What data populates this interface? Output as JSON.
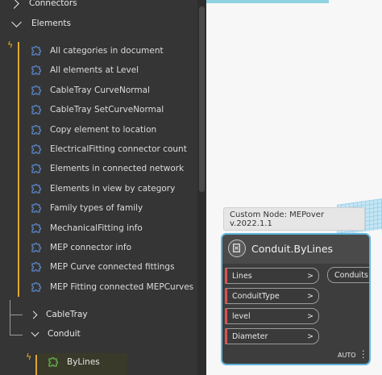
{
  "library": {
    "connectors_label": "Connectors",
    "elements_label": "Elements",
    "items": [
      {
        "label": "All categories in document"
      },
      {
        "label": "All elements at Level"
      },
      {
        "label": "CableTray CurveNormal"
      },
      {
        "label": "CableTray SetCurveNormal"
      },
      {
        "label": "Copy element to location"
      },
      {
        "label": "ElectricalFitting connector count"
      },
      {
        "label": "Elements in connected network"
      },
      {
        "label": "Elements in view by category"
      },
      {
        "label": "Family types of family"
      },
      {
        "label": "MechanicalFitting info"
      },
      {
        "label": "MEP connector info"
      },
      {
        "label": "MEP Curve connected fittings"
      },
      {
        "label": "MEP Fitting connected MEPCurves"
      }
    ],
    "cabletray_label": "CableTray",
    "conduit_label": "Conduit",
    "bylines_label": "ByLines"
  },
  "tooltip": {
    "text": "Custom Node: MEPover v.2022.1.1"
  },
  "node": {
    "title": "Conduit.ByLines",
    "inputs": [
      {
        "name": "Lines",
        "arrow": ">"
      },
      {
        "name": "ConduitType",
        "arrow": ">"
      },
      {
        "name": "level",
        "arrow": ">"
      },
      {
        "name": "Diameter",
        "arrow": ">"
      }
    ],
    "output": "Conduits",
    "lacing": "AUTO"
  },
  "colors": {
    "accent_gold": "#e2a72e",
    "node_border": "#5eb3dc",
    "port_marker": "#d9534f",
    "icon_blue": "#5b86c6",
    "icon_green": "#66b84a"
  },
  "icons": {
    "item_icon": "custom-node-puzzle-icon",
    "bolt": "lightning-icon",
    "node": "custom-node-icon"
  }
}
